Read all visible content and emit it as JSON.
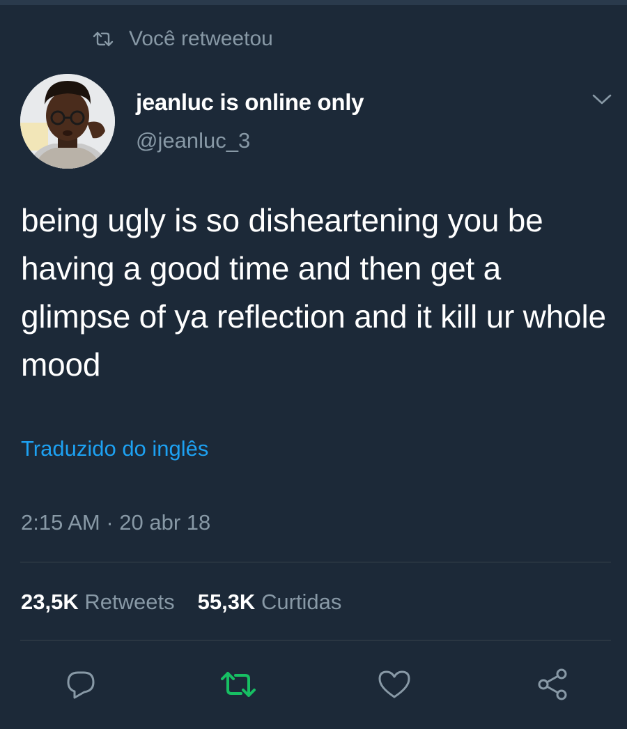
{
  "context": {
    "icon": "retweet-icon",
    "text": "Você retweetou"
  },
  "author": {
    "name": "jeanluc is online only",
    "handle": "@jeanluc_3",
    "avatar": "avatar-photo"
  },
  "tweet": {
    "text": "being ugly is so disheartening you be having a good time and then get a glimpse of ya reflection and it kill ur whole mood",
    "translate_link": "Traduzido do inglês",
    "timestamp": "2:15 AM · 20 abr 18"
  },
  "stats": {
    "retweets_count": "23,5K",
    "retweets_label": "Retweets",
    "likes_count": "55,3K",
    "likes_label": "Curtidas"
  },
  "actions": [
    {
      "icon": "reply-icon"
    },
    {
      "icon": "retweet-icon",
      "active": true
    },
    {
      "icon": "like-icon"
    },
    {
      "icon": "share-icon"
    }
  ],
  "colors": {
    "background": "#1c2938",
    "secondary_text": "#8899a6",
    "link": "#1da1f2",
    "retweet_active": "#17bf63",
    "divider": "#38444d"
  }
}
